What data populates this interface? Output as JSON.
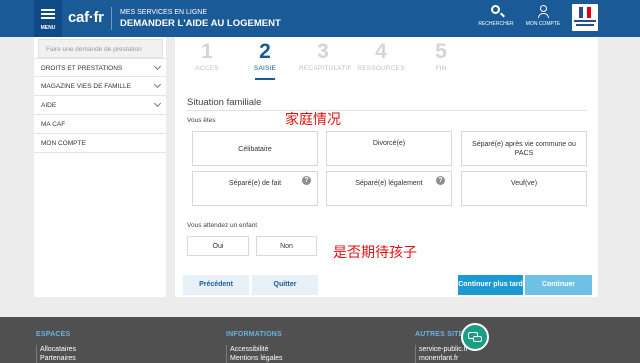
{
  "header": {
    "menu_label": "MENU",
    "logo": "caf·fr",
    "service_small": "MES SERVICES EN LIGNE",
    "service_title": "DEMANDER L'AIDE AU LOGEMENT",
    "search_label": "RECHERCHER",
    "account_label": "MON COMPTE",
    "republique_logo": "marianne-republique-francaise-logo"
  },
  "sidebar": {
    "search_placeholder": "Faire une demande de prestation",
    "items": [
      {
        "label": "DROITS ET PRESTATIONS",
        "has_chevron": true
      },
      {
        "label": "MAGAZINE VIES DE FAMILLE",
        "has_chevron": true
      },
      {
        "label": "AIDE",
        "has_chevron": true
      },
      {
        "label": "MA CAF",
        "has_chevron": false
      },
      {
        "label": "MON COMPTE",
        "has_chevron": false
      }
    ]
  },
  "steps": [
    {
      "num": "1",
      "label": "ACCES",
      "active": false
    },
    {
      "num": "2",
      "label": "SAISIE",
      "active": true
    },
    {
      "num": "3",
      "label": "RECAPITULATIF",
      "active": false
    },
    {
      "num": "4",
      "label": "RESSOURCES",
      "active": false
    },
    {
      "num": "5",
      "label": "FIN",
      "active": false
    }
  ],
  "form": {
    "section_title": "Situation familiale",
    "annotation_1": "家庭情况",
    "vous_etes_label": "Vous êtes",
    "options": [
      {
        "label": "Célibataire",
        "help": false
      },
      {
        "label": "Divorcé(e)",
        "help": false
      },
      {
        "label": "Séparé(e) après vie commune ou PACS",
        "help": false
      },
      {
        "label": "Séparé(e) de fait",
        "help": true
      },
      {
        "label": "Séparé(e) légalement",
        "help": true
      },
      {
        "label": "Veuf(ve)",
        "help": false
      }
    ],
    "enfant_label": "Vous attendez un enfant",
    "oui": "Oui",
    "non": "Non",
    "annotation_2": "是否期待孩子",
    "help_glyph": "?"
  },
  "actions": {
    "precedent": "Précédent",
    "quitter": "Quitter",
    "continuer_plus_tard": "Continuer plus tard",
    "continuer": "Continuer"
  },
  "footer": {
    "espaces_title": "ESPACES",
    "espaces_links": [
      "Allocataires",
      "Partenaires"
    ],
    "informations_title": "INFORMATIONS",
    "informations_links": [
      "Accessibilité",
      "Mentions légales"
    ],
    "autres_title": "AUTRES SITES",
    "autres_links": [
      "service-public.fr",
      "monenfant.fr"
    ]
  },
  "colors": {
    "header_blue": "#1a5a97",
    "action_blue": "#1b9ad3",
    "annotation_red": "#e01010",
    "footer_gray": "#505050",
    "chat_green": "#1c9e84"
  }
}
